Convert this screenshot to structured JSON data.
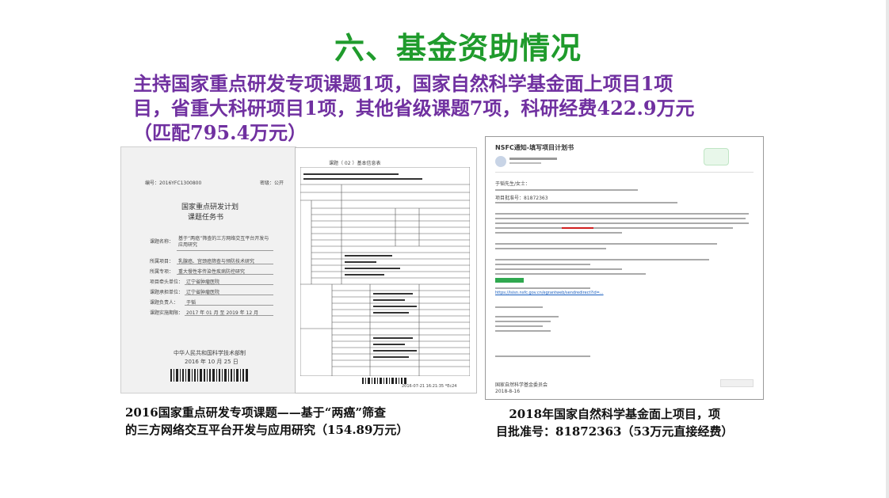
{
  "title": "六、基金资助情况",
  "summary": {
    "line1": "主持国家重点研发专项课题1项，国家自然科学基金面上项目1项",
    "line2": "目，省重大科研项目1项，其他省级课题7项，科研经费422.9万元",
    "line3": "（匹配795.4万元）"
  },
  "doc_left": {
    "number": "编号：2016YFC1300800",
    "secret": "密级：公开",
    "heading1": "国家重点研发计划",
    "heading2": "课题任务书",
    "fields": [
      {
        "label": "课题名称：",
        "value": "基于“两癌”筛查的三方网络交互平台开发与应用研究"
      },
      {
        "label": "所属项目：",
        "value": "乳腺癌、宫颈癌筛查与预防技术研究"
      },
      {
        "label": "所属专项：",
        "value": "重大慢性非传染性疾病防控研究"
      },
      {
        "label": "项目牵头单位：",
        "value": "辽宁省肿瘤医院"
      },
      {
        "label": "课题承担单位：",
        "value": "辽宁省肿瘤医院"
      },
      {
        "label": "课题负责人：",
        "value": "于韬"
      },
      {
        "label": "课题实施期限：",
        "value": "2017 年 01 月 至 2019 年 12 月"
      }
    ],
    "footer1": "中华人民共和国科学技术部制",
    "footer2": "2016 年 10 月 25 日"
  },
  "doc_mid": {
    "header": "课题（    02    ）基本信息表",
    "footer": "2016-07-21 16:21:35  *Ec24"
  },
  "doc_right": {
    "subject": "NSFC通知-填写项目计划书",
    "greeting": "于韬先生/女士：",
    "project_no_label": "项目批准号：81872363",
    "link_text": "https://isisn.nsfc.gov.cn/egrantweb/sendredirect?id=...",
    "sender": "国家自然科学基金委员会",
    "date": "2018-8-16"
  },
  "captions": {
    "left_line1": "2016国家重点研发专项课题——基于“两癌”筛查",
    "left_line2": "的三方网络交互平台开发与应用研究（154.89万元）",
    "right_line1": "2018年国家自然科学基金面上项目，项",
    "right_line2": "目批准号：81872363（53万元直接经费）"
  },
  "colors": {
    "title": "#1f9b2c",
    "summary": "#7030a0",
    "caption": "#111111"
  }
}
